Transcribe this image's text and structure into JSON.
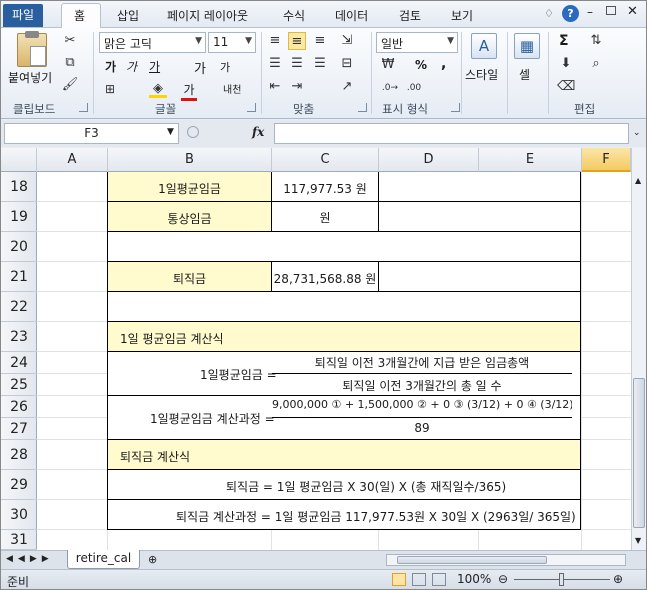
{
  "ribbon_tabs": [
    "파일",
    "홈",
    "삽입",
    "페이지 레이아웃",
    "수식",
    "데이터",
    "검토",
    "보기"
  ],
  "ribbon": {
    "clipboard": {
      "paste": "붙여넣기",
      "label": "클립보드"
    },
    "font": {
      "name": "맑은 고딕",
      "size": "11",
      "bold": "가",
      "italic": "가",
      "underline": "가",
      "grow": "가",
      "shrink": "가",
      "color_letter": "가",
      "phonetic": "내천",
      "label": "글꼴"
    },
    "alignment": {
      "label": "맞춤"
    },
    "number": {
      "format": "일반",
      "percent": "%",
      "comma": ",",
      "label": "표시 형식"
    },
    "styles": {
      "button": "스타일",
      "label": ""
    },
    "cells": {
      "button": "셀",
      "label": ""
    },
    "editing": {
      "sum": "Σ",
      "label": "편집"
    }
  },
  "formula_bar": {
    "name_box": "F3",
    "fx": "fx",
    "content": ""
  },
  "columns": [
    "A",
    "B",
    "C",
    "D",
    "E",
    "F"
  ],
  "rows": [
    "18",
    "19",
    "20",
    "21",
    "22",
    "23",
    "24",
    "25",
    "26",
    "27",
    "28",
    "29",
    "30",
    "31"
  ],
  "cells": {
    "b18": "1일평균임금",
    "c18": "117,977.53 원",
    "b19": "통상임금",
    "c19": "원",
    "b21": "퇴직금",
    "c21": "28,731,568.88 원",
    "b23": "1일 평균임금 계산식",
    "f24_label": "1일평균임금 =",
    "f24_num": "퇴직일 이전 3개월간에 지급 받은 임금총액",
    "f24_den": "퇴직일 이전 3개월간의 총 일 수",
    "f26_label": "1일평균임금 계산과정 =",
    "f26_num": "9,000,000 ① + 1,500,000 ② + 0 ③ (3/12) + 0 ④ (3/12)",
    "f26_den": "89",
    "b28": "퇴직금 계산식",
    "b29": "퇴직금 =   1일 평균임금 X 30(일) X (총 재직일수/365)",
    "b30": "퇴직금 계산과정 =   1일 평균임금 117,977.53원 X 30일 X (2963일/ 365일)"
  },
  "sheet_tab": "retire_cal",
  "status": {
    "ready": "준비",
    "zoom": "100%"
  }
}
